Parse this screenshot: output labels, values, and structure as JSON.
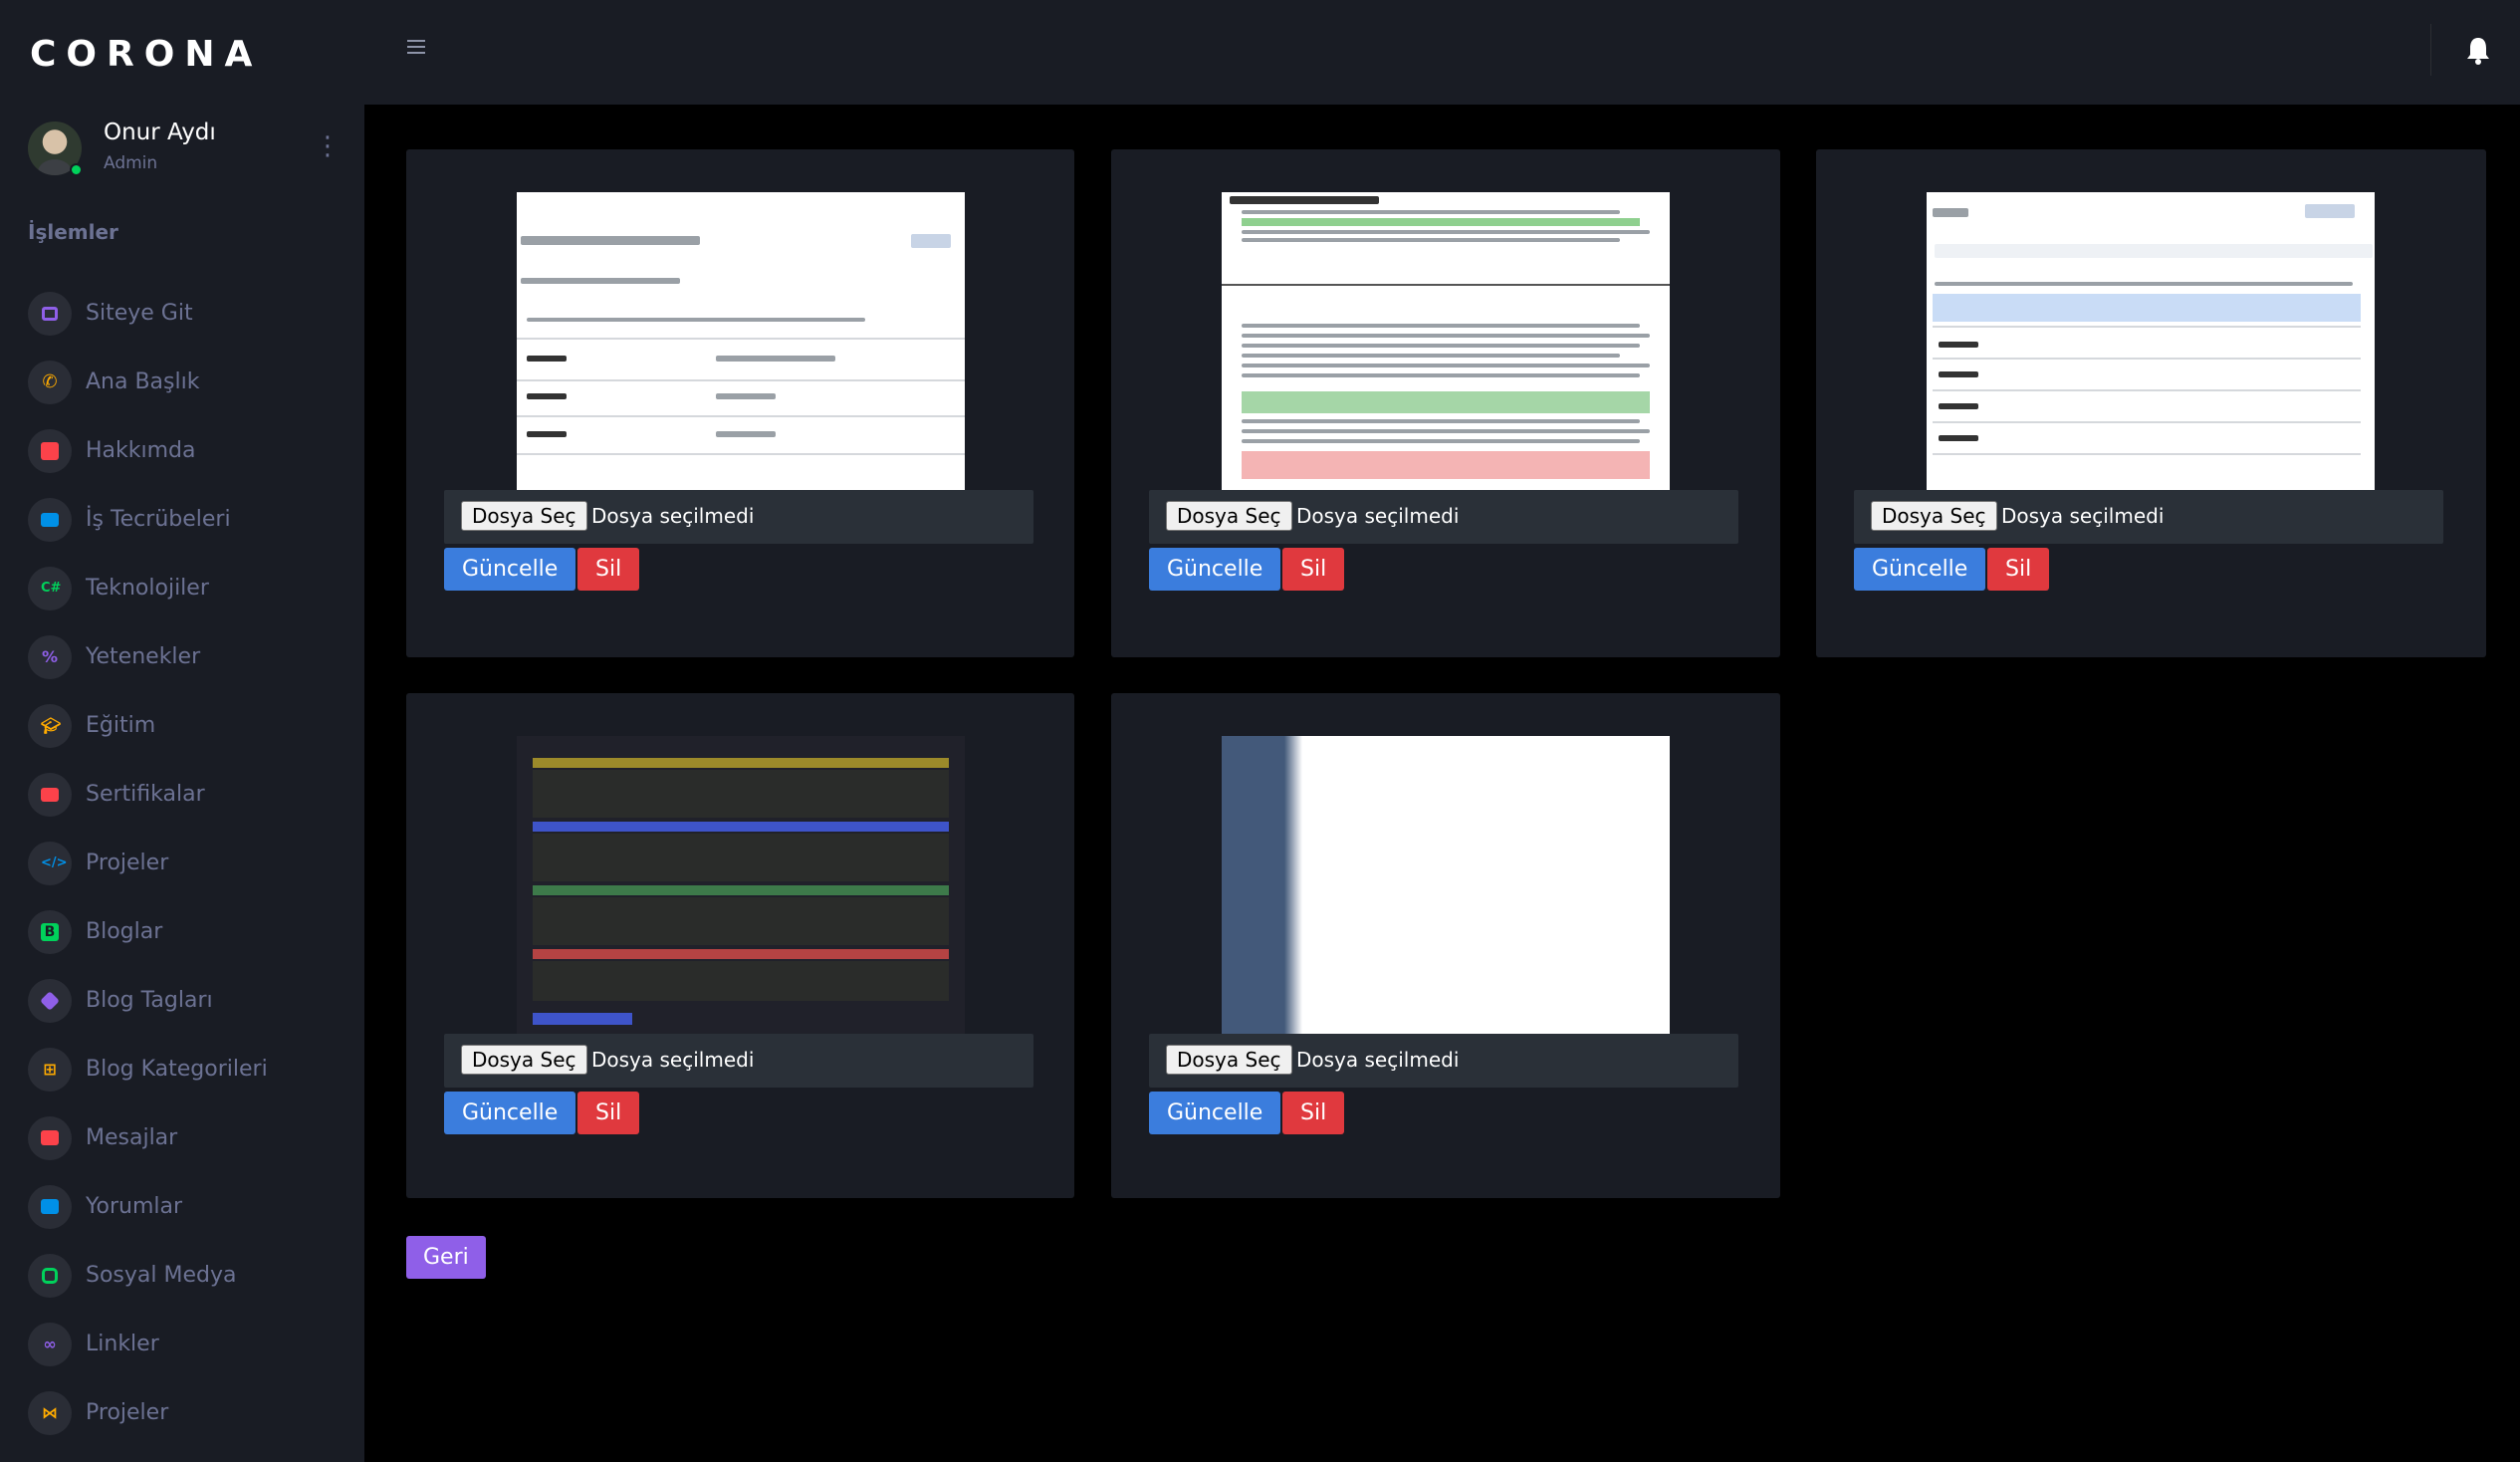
{
  "brand": "CORONA",
  "profile": {
    "name": "Onur Aydı",
    "role": "Admin"
  },
  "sidebar": {
    "section_title": "İşlemler",
    "items": [
      {
        "label": "Siteye Git",
        "icon": "laptop-icon",
        "color": "#8f5fe8"
      },
      {
        "label": "Ana Başlık",
        "icon": "phone-icon",
        "color": "#ffab00"
      },
      {
        "label": "Hakkımda",
        "icon": "contact-card-icon",
        "color": "#fc424a"
      },
      {
        "label": "İş Tecrübeleri",
        "icon": "briefcase-icon",
        "color": "#0090e7"
      },
      {
        "label": "Teknolojiler",
        "icon": "csharp-icon",
        "color": "#00d25b"
      },
      {
        "label": "Yetenekler",
        "icon": "percent-icon",
        "color": "#8f5fe8"
      },
      {
        "label": "Eğitim",
        "icon": "graduation-cap-icon",
        "color": "#ffab00"
      },
      {
        "label": "Sertifikalar",
        "icon": "certificate-icon",
        "color": "#fc424a"
      },
      {
        "label": "Projeler",
        "icon": "code-icon",
        "color": "#0090e7"
      },
      {
        "label": "Bloglar",
        "icon": "blog-icon",
        "color": "#00d25b"
      },
      {
        "label": "Blog Tagları",
        "icon": "tag-icon",
        "color": "#8f5fe8"
      },
      {
        "label": "Blog Kategorileri",
        "icon": "categories-icon",
        "color": "#ffab00"
      },
      {
        "label": "Mesajlar",
        "icon": "message-icon",
        "color": "#fc424a"
      },
      {
        "label": "Yorumlar",
        "icon": "comment-icon",
        "color": "#0090e7"
      },
      {
        "label": "Sosyal Medya",
        "icon": "instagram-icon",
        "color": "#00d25b"
      },
      {
        "label": "Linkler",
        "icon": "link-icon",
        "color": "#8f5fe8"
      },
      {
        "label": "Projeler",
        "icon": "vscode-icon",
        "color": "#ffab00"
      }
    ]
  },
  "cards": [
    {
      "file_button": "Dosya Seç",
      "file_status": "Dosya seçilmedi",
      "update_label": "Güncelle",
      "delete_label": "Sil"
    },
    {
      "file_button": "Dosya Seç",
      "file_status": "Dosya seçilmedi",
      "update_label": "Güncelle",
      "delete_label": "Sil"
    },
    {
      "file_button": "Dosya Seç",
      "file_status": "Dosya seçilmedi",
      "update_label": "Güncelle",
      "delete_label": "Sil"
    },
    {
      "file_button": "Dosya Seç",
      "file_status": "Dosya seçilmedi",
      "update_label": "Güncelle",
      "delete_label": "Sil"
    },
    {
      "file_button": "Dosya Seç",
      "file_status": "Dosya seçilmedi",
      "update_label": "Güncelle",
      "delete_label": "Sil"
    }
  ],
  "back_label": "Geri"
}
